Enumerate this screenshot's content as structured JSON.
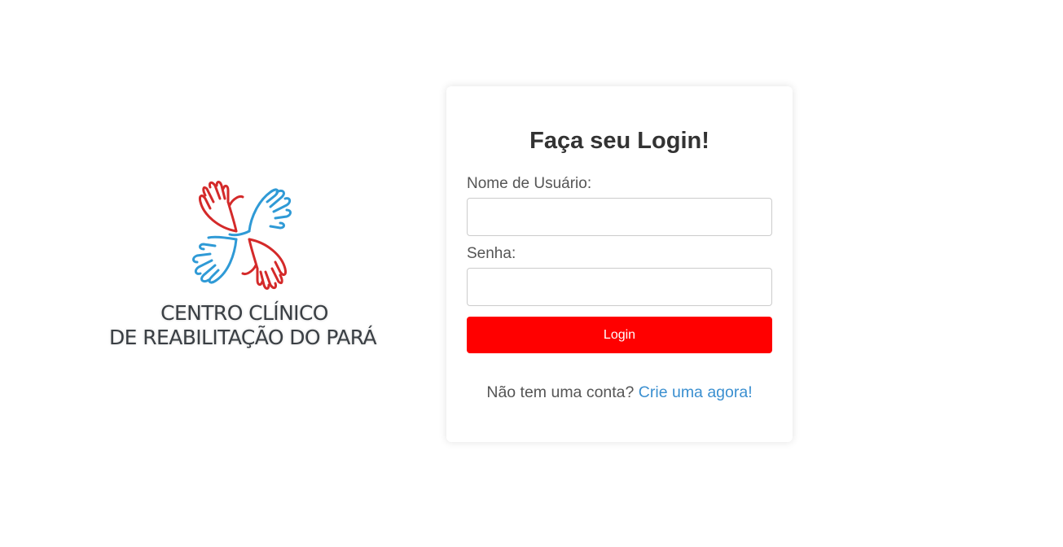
{
  "logo": {
    "line1": "CENTRO CLÍNICO",
    "line2": "DE REABILITAÇÃO DO PARÁ",
    "colors": {
      "red": "#d42a2a",
      "blue": "#2f9ad6",
      "text": "#3a3f44"
    },
    "icon": "four-hands-icon"
  },
  "login_card": {
    "title": "Faça seu Login!",
    "username_label": "Nome de Usuário:",
    "username_value": "",
    "password_label": "Senha:",
    "password_value": "",
    "button_label": "Login",
    "button_color": "#ff0000",
    "signup_prompt": "Não tem uma conta?",
    "signup_link": "Crie uma agora!",
    "link_color": "#3a8fd0"
  }
}
